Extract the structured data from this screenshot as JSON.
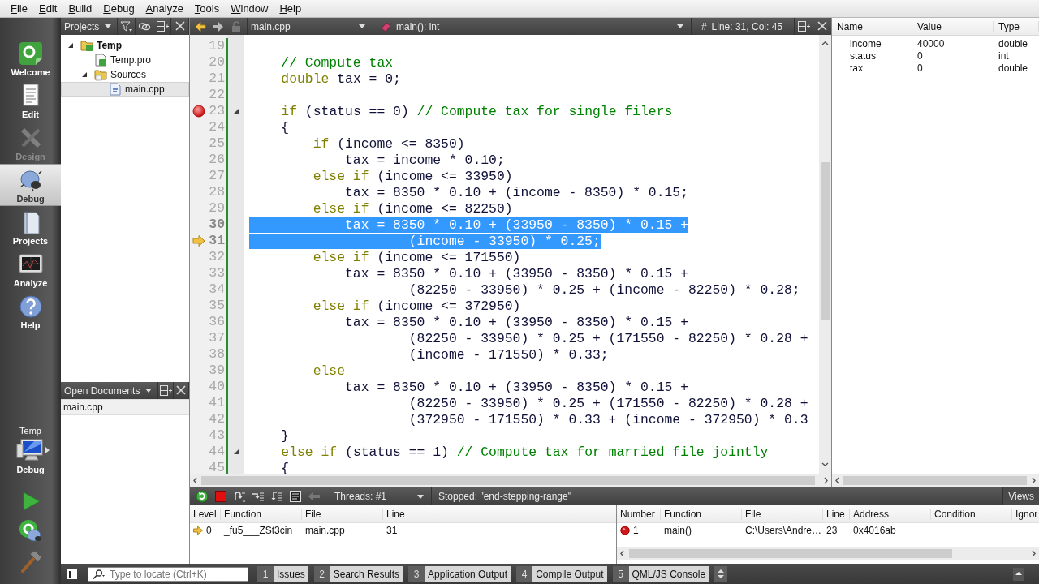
{
  "menu": [
    "File",
    "Edit",
    "Build",
    "Debug",
    "Analyze",
    "Tools",
    "Window",
    "Help"
  ],
  "modes": [
    {
      "label": "Welcome",
      "selected": false,
      "disabled": false
    },
    {
      "label": "Edit",
      "selected": false,
      "disabled": false
    },
    {
      "label": "Design",
      "selected": false,
      "disabled": true
    },
    {
      "label": "Debug",
      "selected": true,
      "disabled": false
    },
    {
      "label": "Projects",
      "selected": false,
      "disabled": false
    },
    {
      "label": "Analyze",
      "selected": false,
      "disabled": false
    },
    {
      "label": "Help",
      "selected": false,
      "disabled": false
    }
  ],
  "kit": {
    "project": "Temp",
    "build": "Debug"
  },
  "projects": {
    "title": "Projects",
    "tree": [
      {
        "label": "Temp",
        "kind": "project",
        "expanded": true,
        "selected": false,
        "children": [
          {
            "label": "Temp.pro",
            "kind": "pro-file",
            "selected": false
          },
          {
            "label": "Sources",
            "kind": "folder",
            "expanded": true,
            "selected": false,
            "children": [
              {
                "label": "main.cpp",
                "kind": "source",
                "selected": true
              }
            ]
          }
        ]
      }
    ]
  },
  "open_documents": {
    "title": "Open Documents",
    "items": [
      {
        "label": "main.cpp",
        "selected": true
      }
    ]
  },
  "editor": {
    "file": "main.cpp",
    "symbol": "main(): int",
    "hash": "#",
    "position": "Line: 31, Col: 45",
    "lines": [
      {
        "number": "19",
        "selected": false,
        "breakpoint": false,
        "current": false,
        "foldable": false
      },
      {
        "number": "20",
        "selected": false,
        "breakpoint": false,
        "current": false,
        "foldable": false,
        "segments": [
          {
            "kind": "comment",
            "text": "    // Compute tax"
          }
        ]
      },
      {
        "number": "21",
        "selected": false,
        "breakpoint": false,
        "current": false,
        "foldable": false,
        "segments": [
          {
            "kind": "keyword",
            "text": "    double"
          },
          {
            "kind": "plain",
            "text": " tax = 0;"
          }
        ]
      },
      {
        "number": "22",
        "selected": false,
        "breakpoint": false,
        "current": false,
        "foldable": false
      },
      {
        "number": "23",
        "selected": false,
        "breakpoint": true,
        "current": false,
        "foldable": true,
        "segments": [
          {
            "kind": "keyword",
            "text": "    if"
          },
          {
            "kind": "plain",
            "text": " (status == 0) "
          },
          {
            "kind": "comment",
            "text": "// Compute tax for single filers"
          }
        ]
      },
      {
        "number": "24",
        "selected": false,
        "breakpoint": false,
        "current": false,
        "foldable": false,
        "segments": [
          {
            "kind": "plain",
            "text": "    {"
          }
        ]
      },
      {
        "number": "25",
        "selected": false,
        "breakpoint": false,
        "current": false,
        "foldable": false,
        "segments": [
          {
            "kind": "keyword",
            "text": "        if"
          },
          {
            "kind": "plain",
            "text": " (income <= 8350)"
          }
        ]
      },
      {
        "number": "26",
        "selected": false,
        "breakpoint": false,
        "current": false,
        "foldable": false,
        "segments": [
          {
            "kind": "plain",
            "text": "            tax = income * 0.10;"
          }
        ]
      },
      {
        "number": "27",
        "selected": false,
        "breakpoint": false,
        "current": false,
        "foldable": false,
        "segments": [
          {
            "kind": "keyword",
            "text": "        else if"
          },
          {
            "kind": "plain",
            "text": " (income <= 33950)"
          }
        ]
      },
      {
        "number": "28",
        "selected": false,
        "breakpoint": false,
        "current": false,
        "foldable": false,
        "segments": [
          {
            "kind": "plain",
            "text": "            tax = 8350 * 0.10 + (income - 8350) * 0.15;"
          }
        ]
      },
      {
        "number": "29",
        "selected": false,
        "breakpoint": false,
        "current": false,
        "foldable": false,
        "segments": [
          {
            "kind": "keyword",
            "text": "        else if"
          },
          {
            "kind": "plain",
            "text": " (income <= 82250)"
          }
        ]
      },
      {
        "number": "30",
        "selected": true,
        "breakpoint": false,
        "current": false,
        "foldable": false,
        "segments": [
          {
            "kind": "selected",
            "text": "            tax = 8350 * 0.10 + (33950 - 8350) * 0.15 +"
          }
        ]
      },
      {
        "number": "31",
        "selected": true,
        "breakpoint": false,
        "current": true,
        "foldable": false,
        "segments": [
          {
            "kind": "selected",
            "text": "                    (income - 33950) * 0.25;"
          }
        ]
      },
      {
        "number": "32",
        "selected": false,
        "breakpoint": false,
        "current": false,
        "foldable": false,
        "segments": [
          {
            "kind": "keyword",
            "text": "        else if"
          },
          {
            "kind": "plain",
            "text": " (income <= 171550)"
          }
        ]
      },
      {
        "number": "33",
        "selected": false,
        "breakpoint": false,
        "current": false,
        "foldable": false,
        "segments": [
          {
            "kind": "plain",
            "text": "            tax = 8350 * 0.10 + (33950 - 8350) * 0.15 +"
          }
        ]
      },
      {
        "number": "34",
        "selected": false,
        "breakpoint": false,
        "current": false,
        "foldable": false,
        "segments": [
          {
            "kind": "plain",
            "text": "                    (82250 - 33950) * 0.25 + (income - 82250) * 0.28;"
          }
        ]
      },
      {
        "number": "35",
        "selected": false,
        "breakpoint": false,
        "current": false,
        "foldable": false,
        "segments": [
          {
            "kind": "keyword",
            "text": "        else if"
          },
          {
            "kind": "plain",
            "text": " (income <= 372950)"
          }
        ]
      },
      {
        "number": "36",
        "selected": false,
        "breakpoint": false,
        "current": false,
        "foldable": false,
        "segments": [
          {
            "kind": "plain",
            "text": "            tax = 8350 * 0.10 + (33950 - 8350) * 0.15 +"
          }
        ]
      },
      {
        "number": "37",
        "selected": false,
        "breakpoint": false,
        "current": false,
        "foldable": false,
        "segments": [
          {
            "kind": "plain",
            "text": "                    (82250 - 33950) * 0.25 + (171550 - 82250) * 0.28 +"
          }
        ]
      },
      {
        "number": "38",
        "selected": false,
        "breakpoint": false,
        "current": false,
        "foldable": false,
        "segments": [
          {
            "kind": "plain",
            "text": "                    (income - 171550) * 0.33;"
          }
        ]
      },
      {
        "number": "39",
        "selected": false,
        "breakpoint": false,
        "current": false,
        "foldable": false,
        "segments": [
          {
            "kind": "keyword",
            "text": "        else"
          }
        ]
      },
      {
        "number": "40",
        "selected": false,
        "breakpoint": false,
        "current": false,
        "foldable": false,
        "segments": [
          {
            "kind": "plain",
            "text": "            tax = 8350 * 0.10 + (33950 - 8350) * 0.15 +"
          }
        ]
      },
      {
        "number": "41",
        "selected": false,
        "breakpoint": false,
        "current": false,
        "foldable": false,
        "segments": [
          {
            "kind": "plain",
            "text": "                    (82250 - 33950) * 0.25 + (171550 - 82250) * 0.28 +"
          }
        ]
      },
      {
        "number": "42",
        "selected": false,
        "breakpoint": false,
        "current": false,
        "foldable": false,
        "segments": [
          {
            "kind": "plain",
            "text": "                    (372950 - 171550) * 0.33 + (income - 372950) * 0.3"
          }
        ]
      },
      {
        "number": "43",
        "selected": false,
        "breakpoint": false,
        "current": false,
        "foldable": false,
        "segments": [
          {
            "kind": "plain",
            "text": "    }"
          }
        ]
      },
      {
        "number": "44",
        "selected": false,
        "breakpoint": false,
        "current": false,
        "foldable": true,
        "segments": [
          {
            "kind": "keyword",
            "text": "    else if"
          },
          {
            "kind": "plain",
            "text": " (status == 1) "
          },
          {
            "kind": "comment",
            "text": "// Compute tax for married file jointly"
          }
        ]
      },
      {
        "number": "45",
        "selected": false,
        "breakpoint": false,
        "current": false,
        "foldable": false,
        "segments": [
          {
            "kind": "plain",
            "text": "    {"
          }
        ]
      }
    ]
  },
  "locals": {
    "columns": [
      "Name",
      "Value",
      "Type"
    ],
    "rows": [
      {
        "name": "income",
        "value": "40000",
        "type": "double"
      },
      {
        "name": "status",
        "value": "0",
        "type": "int"
      },
      {
        "name": "tax",
        "value": "0",
        "type": "double"
      }
    ]
  },
  "debugger": {
    "threads": "Threads: #1",
    "status": "Stopped: \"end-stepping-range\"",
    "views": "Views",
    "stack": {
      "columns": [
        "Level",
        "Function",
        "File",
        "Line"
      ],
      "rows": [
        {
          "level": "0",
          "function": "_fu5___ZSt3cin",
          "file": "main.cpp",
          "line": "31",
          "current": true
        }
      ]
    },
    "breakpoints": {
      "columns": [
        "Number",
        "Function",
        "File",
        "Line",
        "Address",
        "Condition",
        "Ignor"
      ],
      "rows": [
        {
          "number": "1",
          "function": "main()",
          "file": "C:\\Users\\Andre…",
          "line": "23",
          "address": "0x4016ab",
          "enabled": true
        }
      ]
    }
  },
  "status_bar": {
    "locate_placeholder": "Type to locate (Ctrl+K)",
    "output_tabs": [
      {
        "number": "1",
        "label": "Issues"
      },
      {
        "number": "2",
        "label": "Search Results"
      },
      {
        "number": "3",
        "label": "Application Output"
      },
      {
        "number": "4",
        "label": "Compile Output"
      },
      {
        "number": "5",
        "label": "QML/JS Console"
      }
    ]
  }
}
